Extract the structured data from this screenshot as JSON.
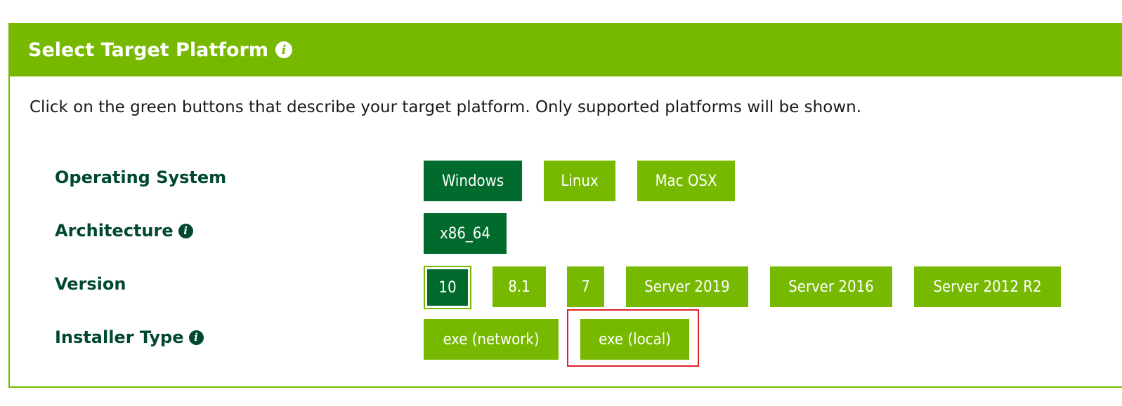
{
  "header": {
    "title": "Select Target Platform",
    "info_glyph": "i"
  },
  "instructions": "Click on the green buttons that describe your target platform. Only supported platforms will be shown.",
  "rows": {
    "os": {
      "label": "Operating System",
      "options": [
        "Windows",
        "Linux",
        "Mac OSX"
      ],
      "selected": "Windows"
    },
    "arch": {
      "label": "Architecture",
      "options": [
        "x86_64"
      ],
      "selected": "x86_64"
    },
    "version": {
      "label": "Version",
      "options": [
        "10",
        "8.1",
        "7",
        "Server 2019",
        "Server 2016",
        "Server 2012 R2"
      ],
      "selected": "10"
    },
    "installer": {
      "label": "Installer Type",
      "options": [
        "exe (network)",
        "exe (local)"
      ],
      "selected": null
    }
  },
  "colors": {
    "accent_green": "#76b900",
    "selected_green": "#006b2d",
    "label_dark_green": "#004831",
    "highlight_red": "#e0202a"
  },
  "icons": {
    "info": "info-icon"
  }
}
